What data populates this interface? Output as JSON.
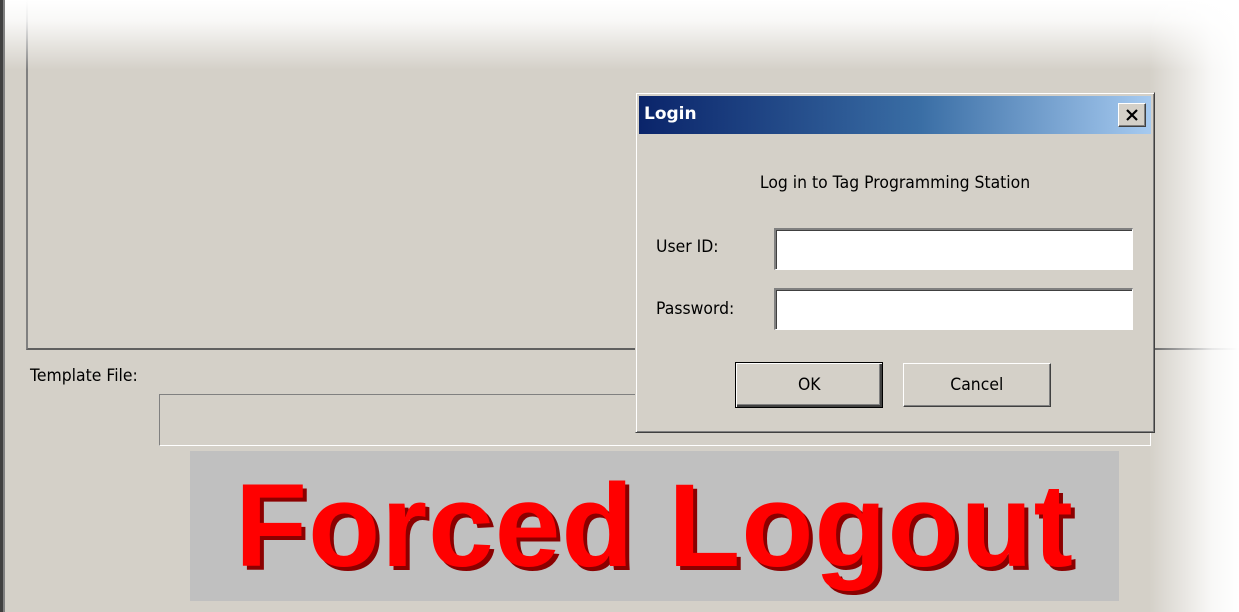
{
  "main_window": {
    "template_file_label": "Template File:",
    "template_file_value": "",
    "banner_text": "Forced Logout"
  },
  "dialog": {
    "title": "Login",
    "close_icon": "close-icon",
    "subtitle": "Log in to Tag Programming Station",
    "user_id_label": "User ID:",
    "user_id_value": "",
    "password_label": "Password:",
    "password_value": "",
    "ok_label": "OK",
    "cancel_label": "Cancel"
  },
  "colors": {
    "window_face": "#d4d0c8",
    "titlebar_start": "#0a246a",
    "titlebar_end": "#a6caf0",
    "banner_text": "#ff0000",
    "banner_background": "#c0c0c0"
  }
}
